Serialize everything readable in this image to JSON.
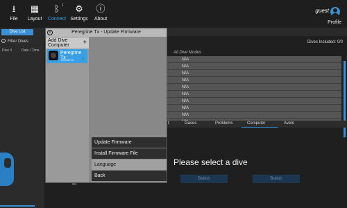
{
  "toolbar": {
    "items": [
      {
        "label": "File",
        "icon": "download-icon"
      },
      {
        "label": "Layout",
        "icon": "layout-icon"
      },
      {
        "label": "Connect",
        "icon": "bluetooth-icon",
        "badge": "1"
      },
      {
        "label": "Settings",
        "icon": "gear-icon"
      },
      {
        "label": "About",
        "icon": "info-icon"
      }
    ],
    "profile": {
      "name": "guest",
      "label": "Profile"
    }
  },
  "sidebar": {
    "tab_label": "Dive List",
    "filter_placeholder": "Filter Dives",
    "columns": [
      "Dive #",
      "Date / Time"
    ]
  },
  "main": {
    "dives_included": "Dives Included: 0/0",
    "grid_header": "All Dive Modes",
    "grid_rows": [
      "N/A",
      "N/A",
      "N/A",
      "N/A",
      "N/A",
      "N/A",
      "N/A",
      "N/A",
      "N/A",
      "N/A"
    ],
    "lower_tabs": [
      "t",
      "Gases",
      "Problems",
      "Computer",
      "Avelo"
    ],
    "placeholder": "Please select a dive",
    "buttons": [
      "Button",
      "Button"
    ]
  },
  "dialog": {
    "title": "Peregrine Tx - Update Firmware",
    "add_label_line1": "Add Dive",
    "add_label_line2": "Computer",
    "device": {
      "name": "Peregrine Tx",
      "serial": "10DE8E16"
    },
    "menu": [
      "Update Firmware",
      "Install Firmware File",
      "Language",
      "Back"
    ]
  },
  "colors": {
    "accent": "#3aa0e6",
    "dialog_bg": "#888888",
    "menu_bg": "#2e2e2e"
  }
}
